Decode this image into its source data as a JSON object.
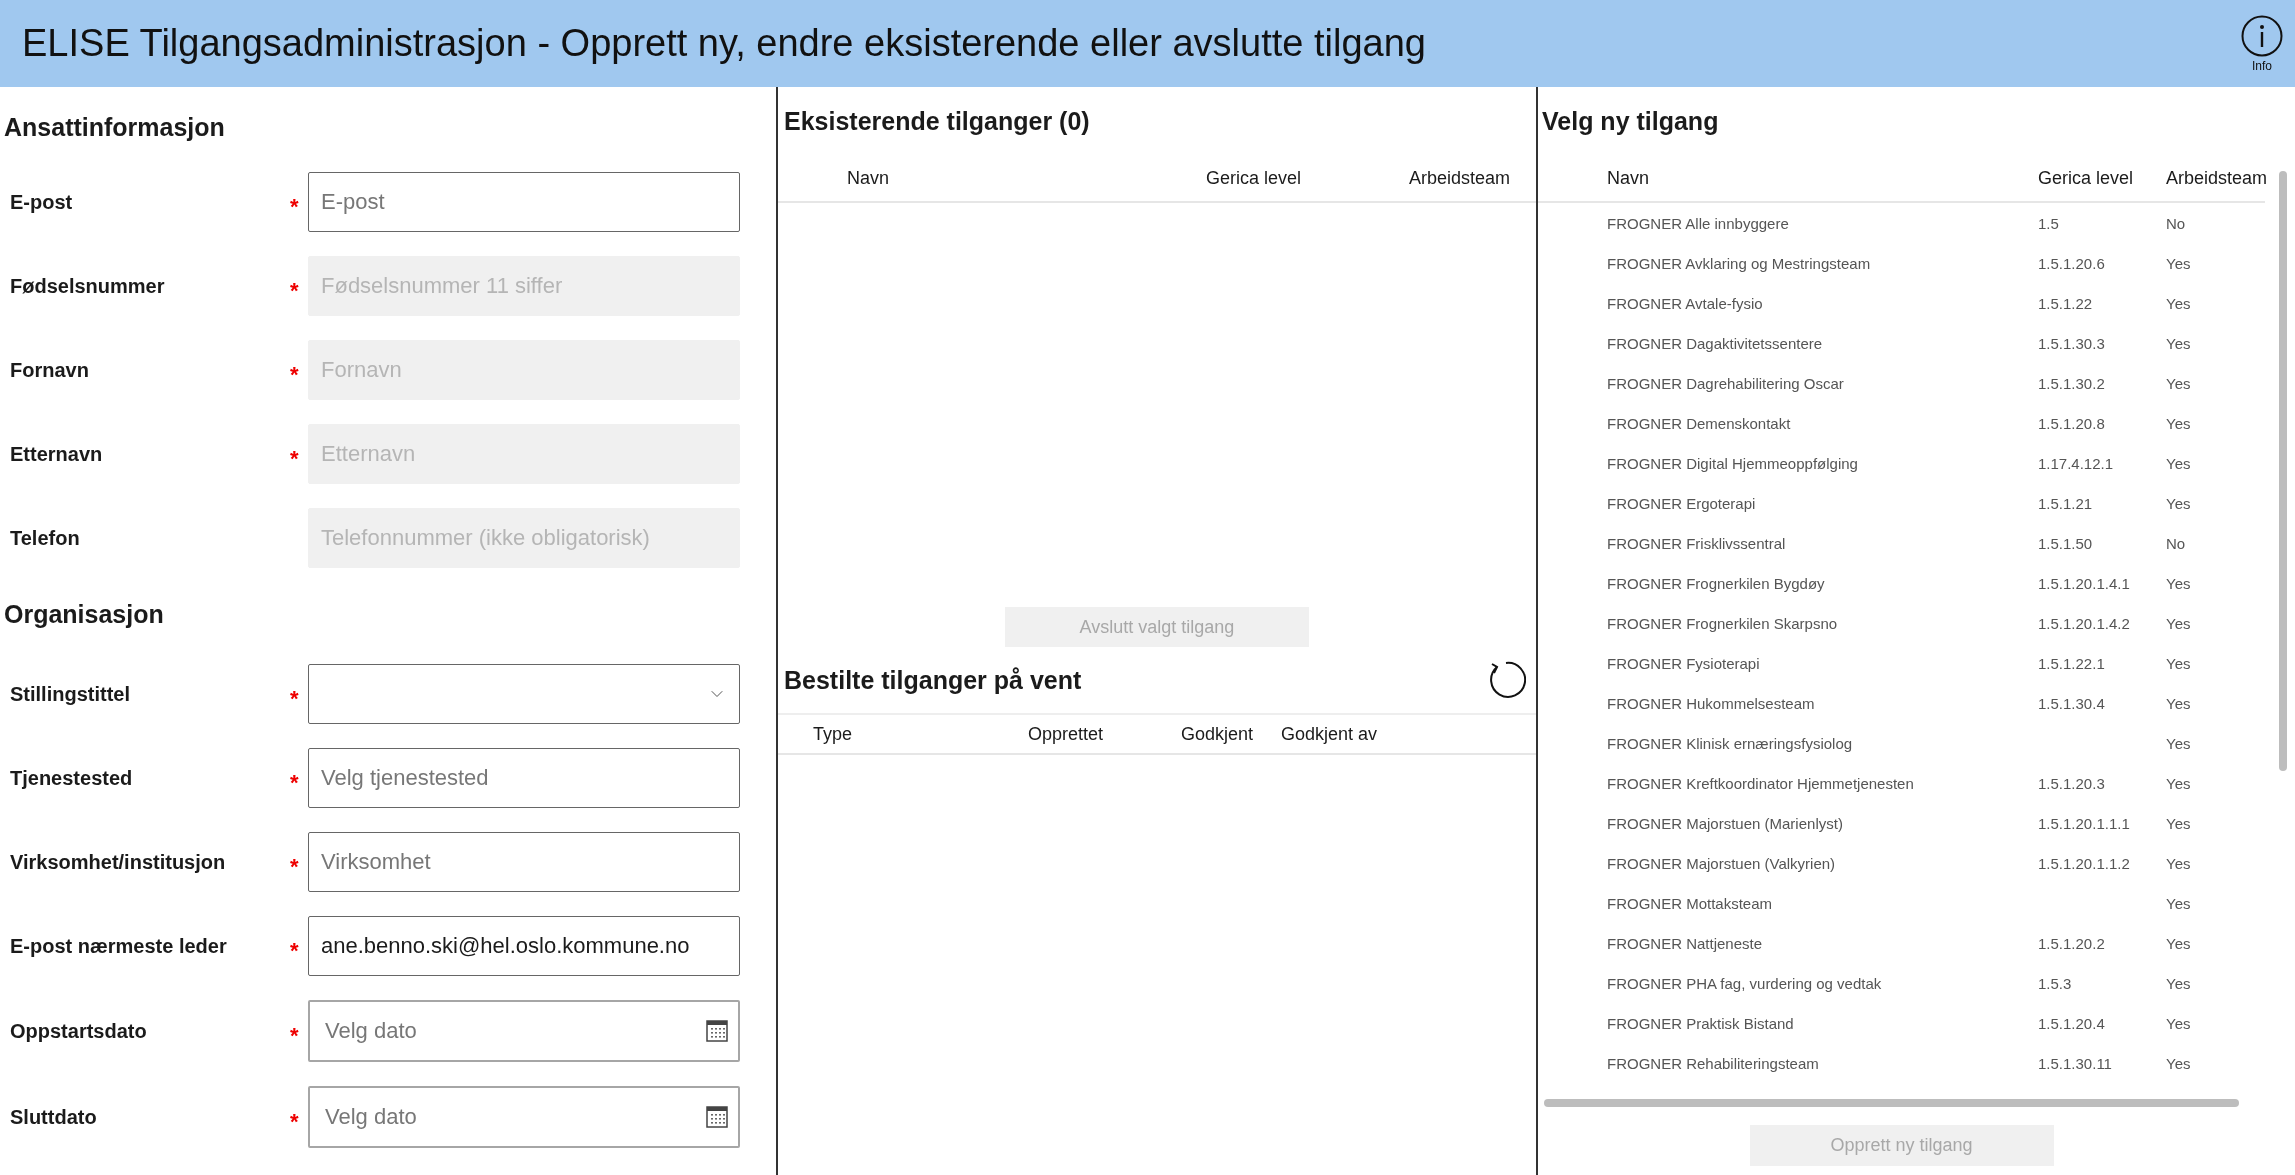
{
  "header": {
    "title": "ELISE Tilgangsadministrasjon - Opprett ny, endre eksisterende eller avslutte tilgang",
    "info_label": "Info"
  },
  "employee": {
    "title": "Ansattinformasjon",
    "fields": [
      {
        "label": "E-post",
        "required_mark": "*",
        "kind": "text",
        "disabled": false,
        "placeholder": "E-post"
      },
      {
        "label": "Fødselsnummer",
        "required_mark": "*",
        "kind": "text",
        "disabled": true,
        "placeholder": "Fødselsnummer 11 siffer"
      },
      {
        "label": "Fornavn",
        "required_mark": "*",
        "kind": "text",
        "disabled": true,
        "placeholder": "Fornavn"
      },
      {
        "label": "Etternavn",
        "required_mark": "*",
        "kind": "text",
        "disabled": true,
        "placeholder": "Etternavn"
      },
      {
        "label": "Telefon",
        "kind": "text",
        "disabled": true,
        "placeholder": "Telefonnummer (ikke obligatorisk)"
      }
    ]
  },
  "organisation": {
    "title": "Organisasjon",
    "fields": [
      {
        "label": "Stillingstittel",
        "required_mark": "*",
        "kind": "select",
        "disabled": false
      },
      {
        "label": "Tjenestested",
        "required_mark": "*",
        "kind": "text",
        "disabled": false,
        "placeholder": "Velg tjenestested"
      },
      {
        "label": "Virksomhet/institusjon",
        "required_mark": "*",
        "kind": "text",
        "disabled": false,
        "placeholder": "Virksomhet"
      },
      {
        "label": "E-post nærmeste leder",
        "required_mark": "*",
        "kind": "text",
        "disabled": false,
        "value": "ane.benno.ski@hel.oslo.kommune.no"
      },
      {
        "label": "Oppstartsdato",
        "required_mark": "*",
        "kind": "date",
        "disabled": false,
        "placeholder": "Velg dato"
      },
      {
        "label": "Sluttdato",
        "required_mark": "*",
        "kind": "date",
        "disabled": false,
        "placeholder": "Velg dato"
      }
    ]
  },
  "existing": {
    "title": "Eksisterende tilganger (0)",
    "columns": [
      "Navn",
      "Gerica level",
      "Arbeidsteam"
    ],
    "button": {
      "label": "Avslutt valgt tilgang",
      "disabled": true
    }
  },
  "pending": {
    "title": "Bestilte tilganger på vent",
    "columns": [
      "Type",
      "Opprettet",
      "Godkjent",
      "Godkjent av"
    ]
  },
  "new_access": {
    "title": "Velg ny tilgang",
    "columns": [
      "Navn",
      "Gerica level",
      "Arbeidsteam"
    ],
    "rows": [
      {
        "name": "FROGNER Alle innbyggere",
        "level": "1.5",
        "team": "No"
      },
      {
        "name": "FROGNER Avklaring og Mestringsteam",
        "level": "1.5.1.20.6",
        "team": "Yes"
      },
      {
        "name": "FROGNER Avtale-fysio",
        "level": "1.5.1.22",
        "team": "Yes"
      },
      {
        "name": "FROGNER Dagaktivitetssentere",
        "level": "1.5.1.30.3",
        "team": "Yes"
      },
      {
        "name": "FROGNER Dagrehabilitering Oscar",
        "level": "1.5.1.30.2",
        "team": "Yes"
      },
      {
        "name": "FROGNER Demenskontakt",
        "level": "1.5.1.20.8",
        "team": "Yes"
      },
      {
        "name": "FROGNER Digital Hjemmeoppfølging",
        "level": "1.17.4.12.1",
        "team": "Yes"
      },
      {
        "name": "FROGNER Ergoterapi",
        "level": "1.5.1.21",
        "team": "Yes"
      },
      {
        "name": "FROGNER Frisklivssentral",
        "level": "1.5.1.50",
        "team": "No"
      },
      {
        "name": "FROGNER Frognerkilen Bygdøy",
        "level": "1.5.1.20.1.4.1",
        "team": "Yes"
      },
      {
        "name": "FROGNER Frognerkilen Skarpsno",
        "level": "1.5.1.20.1.4.2",
        "team": "Yes"
      },
      {
        "name": "FROGNER Fysioterapi",
        "level": "1.5.1.22.1",
        "team": "Yes"
      },
      {
        "name": "FROGNER Hukommelsesteam",
        "level": "1.5.1.30.4",
        "team": "Yes"
      },
      {
        "name": "FROGNER Klinisk ernæringsfysiolog",
        "team": "Yes"
      },
      {
        "name": "FROGNER Kreftkoordinator Hjemmetjenesten",
        "level": "1.5.1.20.3",
        "team": "Yes"
      },
      {
        "name": "FROGNER Majorstuen (Marienlyst)",
        "level": "1.5.1.20.1.1.1",
        "team": "Yes"
      },
      {
        "name": "FROGNER Majorstuen (Valkyrien)",
        "level": "1.5.1.20.1.1.2",
        "team": "Yes"
      },
      {
        "name": "FROGNER Mottaksteam",
        "team": "Yes"
      },
      {
        "name": "FROGNER Nattjeneste",
        "level": "1.5.1.20.2",
        "team": "Yes"
      },
      {
        "name": "FROGNER PHA fag, vurdering og vedtak",
        "level": "1.5.3",
        "team": "Yes"
      },
      {
        "name": "FROGNER Praktisk Bistand",
        "level": "1.5.1.20.4",
        "team": "Yes"
      },
      {
        "name": "FROGNER Rehabiliteringsteam",
        "level": "1.5.1.30.11",
        "team": "Yes"
      }
    ],
    "button": {
      "label": "Opprett ny tilgang",
      "disabled": true
    }
  }
}
